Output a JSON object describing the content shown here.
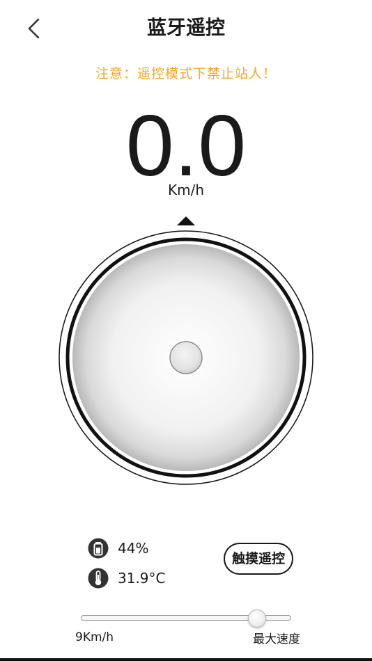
{
  "header": {
    "title": "蓝牙遥控",
    "back_icon": "chevron-left-icon"
  },
  "warning": {
    "text": "注意：遥控模式下禁止站人！",
    "color": "#F5A623"
  },
  "speed": {
    "value": "0.0",
    "unit": "Km/h"
  },
  "status": {
    "battery_icon": "battery-icon",
    "battery": "44%",
    "temperature_icon": "thermometer-icon",
    "temperature": "31.9°C"
  },
  "controls": {
    "touch_button_label": "触摸遥控"
  },
  "speed_slider": {
    "min_label": "9Km/h",
    "max_label": "最大速度",
    "level": 0.87
  },
  "colors": {
    "text": "#1A1A1A",
    "accent": "#F5A623"
  }
}
